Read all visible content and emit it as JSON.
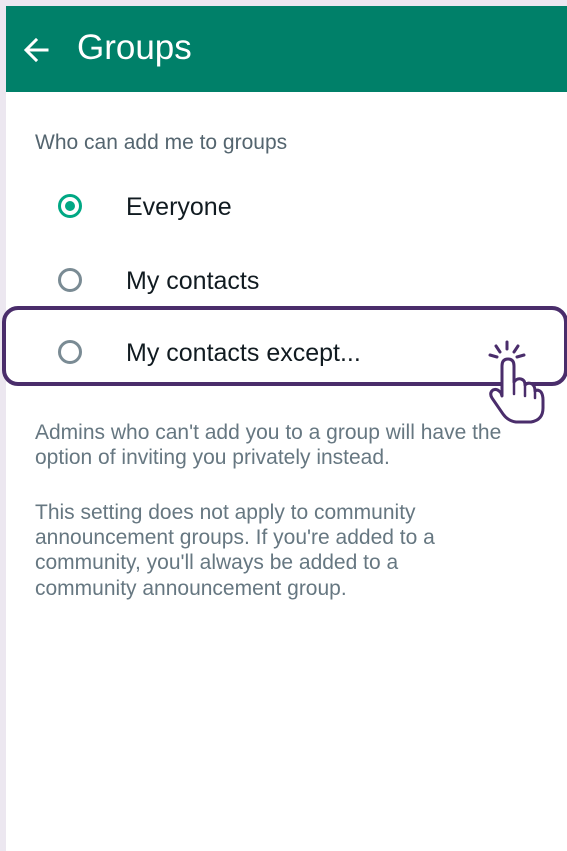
{
  "app_bar": {
    "title": "Groups",
    "back_icon": "arrow-back-icon",
    "color": "#008069"
  },
  "section": {
    "header": "Who can add me to groups"
  },
  "options": [
    {
      "label": "Everyone",
      "selected": true
    },
    {
      "label": "My contacts",
      "selected": false
    },
    {
      "label": "My contacts except...",
      "selected": false
    }
  ],
  "helper": {
    "line1": "Admins who can't add you to a group will have the option of inviting you privately instead.",
    "line2": "This setting does not apply to community announcement groups. If you're added to a community, you'll always be added to a community announcement group."
  },
  "annotation": {
    "highlight_color": "#4a2d6b",
    "cursor_icon": "hand-pointer-click-icon"
  },
  "colors": {
    "accent": "#00a884",
    "unselected_radio": "#7a8b94"
  }
}
